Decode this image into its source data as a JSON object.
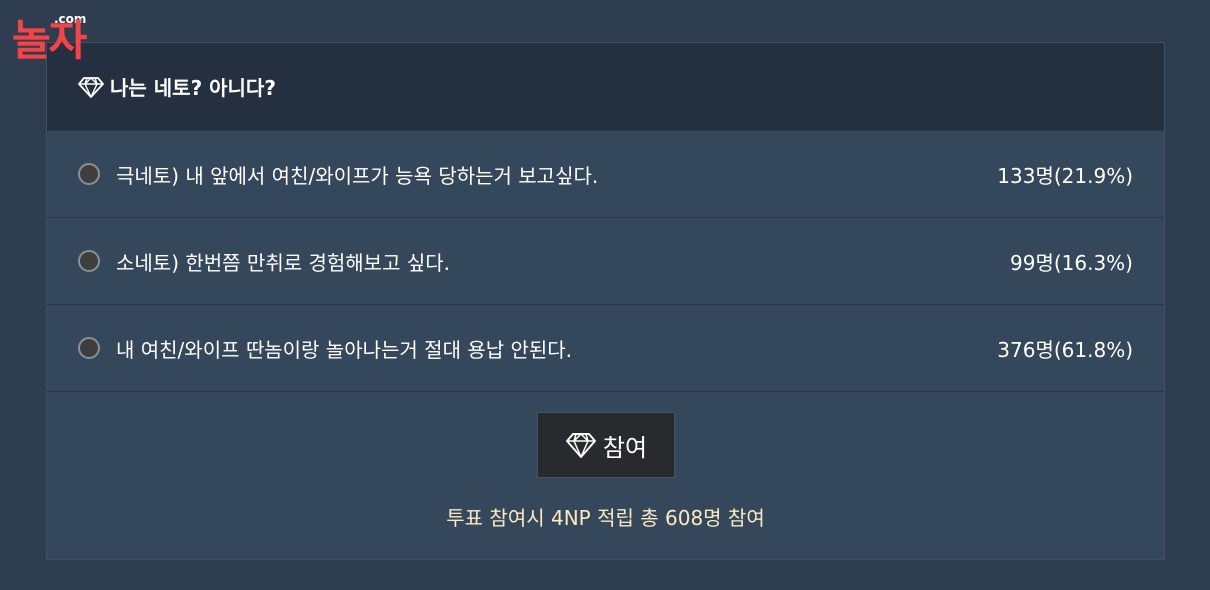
{
  "logo": {
    "main_text": "놀자",
    "sub_text": ".com",
    "color": "#f0454a"
  },
  "poll": {
    "title": "나는 네토? 아니다?",
    "title_icon": "diamond-icon",
    "options": [
      {
        "label": "극네토) 내 앞에서 여친/와이프가 능욕 당하는거 보고싶다.",
        "result": "133명(21.9%)",
        "count": 133,
        "percent": 21.9
      },
      {
        "label": "소네토) 한번쯤 만취로 경험해보고 싶다.",
        "result": "99명(16.3%)",
        "count": 99,
        "percent": 16.3
      },
      {
        "label": "내 여친/와이프 딴놈이랑 놀아나는거 절대 용납 안된다.",
        "result": "376명(61.8%)",
        "count": 376,
        "percent": 61.8
      }
    ],
    "join_button": {
      "label": "참여",
      "icon": "diamond-icon"
    },
    "info_text": "투표 참여시 4NP 적립 총 608명 참여",
    "colors": {
      "header_bg": "#24303f",
      "panel_bg": "#35475b",
      "info_text": "#fbe9c0"
    }
  }
}
